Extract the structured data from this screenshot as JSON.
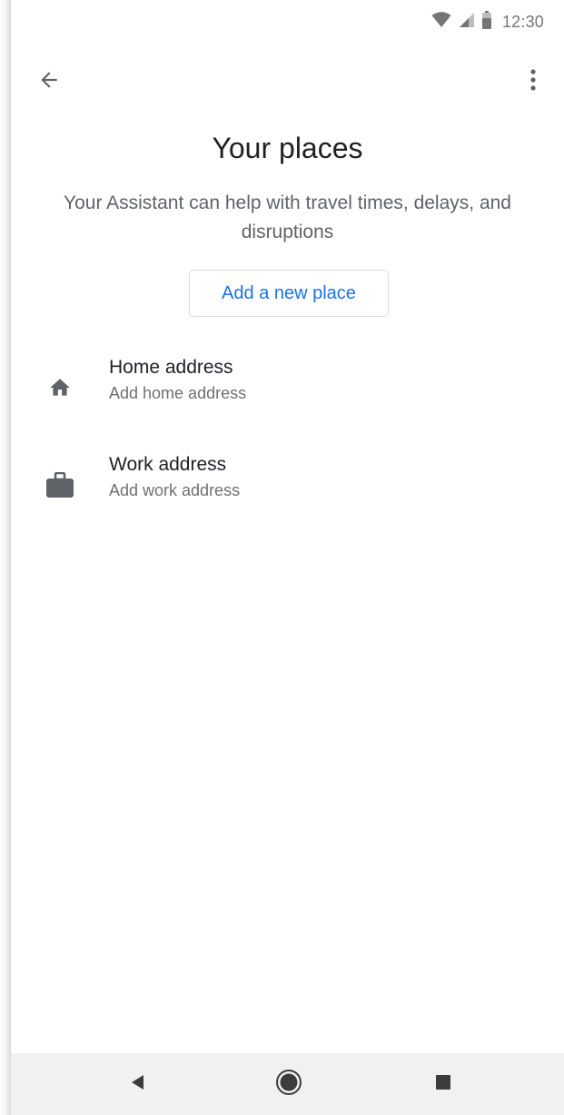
{
  "status_bar": {
    "time": "12:30",
    "icons": [
      "wifi-icon",
      "signal-icon",
      "battery-icon"
    ]
  },
  "app_bar": {
    "back_icon": "arrow-back-icon",
    "menu_icon": "more-vert-icon"
  },
  "header": {
    "title": "Your places",
    "subtitle": "Your Assistant can help with travel times, delays, and disruptions"
  },
  "add_place": {
    "label": "Add a new place"
  },
  "places": [
    {
      "icon": "home-icon",
      "title": "Home address",
      "subtitle": "Add home address"
    },
    {
      "icon": "work-briefcase-icon",
      "title": "Work address",
      "subtitle": "Add work address"
    }
  ],
  "nav_bar": {
    "icons": [
      "nav-back-icon",
      "nav-home-icon",
      "nav-recents-icon"
    ]
  },
  "colors": {
    "accent": "#1a73e8",
    "text_primary": "#202124",
    "text_secondary": "#5f6368",
    "icon_gray": "#5f6368",
    "nav_background": "#f1f1f1"
  }
}
